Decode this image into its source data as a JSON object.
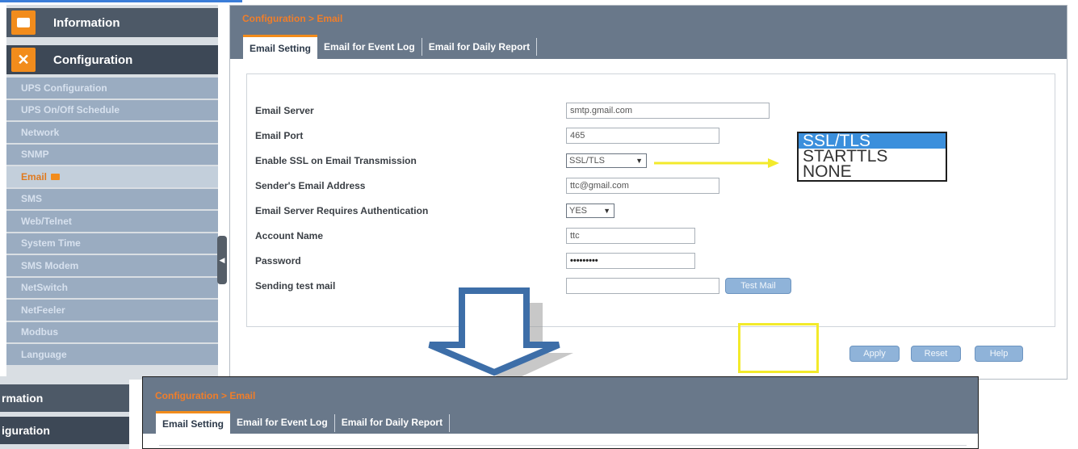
{
  "top": {
    "sidebar": {
      "information_label": "Information",
      "configuration_label": "Configuration",
      "items": [
        {
          "label": "UPS Configuration"
        },
        {
          "label": "UPS On/Off Schedule"
        },
        {
          "label": "Network"
        },
        {
          "label": "SNMP"
        },
        {
          "label": "Email"
        },
        {
          "label": "SMS"
        },
        {
          "label": "Web/Telnet"
        },
        {
          "label": "System Time"
        },
        {
          "label": "SMS Modem"
        },
        {
          "label": "NetSwitch"
        },
        {
          "label": "NetFeeler"
        },
        {
          "label": "Modbus"
        },
        {
          "label": "Language"
        }
      ]
    },
    "breadcrumb": "Configuration > Email",
    "tabs": [
      "Email Setting",
      "Email for Event Log",
      "Email for Daily Report"
    ],
    "form": {
      "email_server_label": "Email Server",
      "email_server_value": "smtp.gmail.com",
      "email_port_label": "Email Port",
      "email_port_value": "465",
      "ssl_label": "Enable SSL on Email Transmission",
      "ssl_value": "SSL/TLS",
      "sender_label": "Sender's Email Address",
      "sender_value": "ttc@gmail.com",
      "auth_label": "Email Server Requires Authentication",
      "auth_value": "YES",
      "account_label": "Account Name",
      "account_value": "ttc",
      "password_label": "Password",
      "password_value": "•••••••••",
      "test_mail_label": "Sending test mail",
      "test_mail_value": "",
      "test_mail_button": "Test Mail"
    },
    "dropdown_options": [
      "SSL/TLS",
      "STARTTLS",
      "NONE"
    ],
    "buttons": {
      "apply": "Apply",
      "reset": "Reset",
      "help": "Help"
    }
  },
  "bottom": {
    "sidebar": {
      "information_label": "rmation",
      "configuration_label": "iguration"
    },
    "breadcrumb": "Configuration > Email",
    "tabs": [
      "Email Setting",
      "Email for Event Log",
      "Email for Daily Report"
    ]
  },
  "colors": {
    "accent_orange": "#f28c1c",
    "header_gray": "#69788a",
    "annotation_yellow": "#f3ea2b",
    "arrow_blue": "#3d6ea8"
  }
}
